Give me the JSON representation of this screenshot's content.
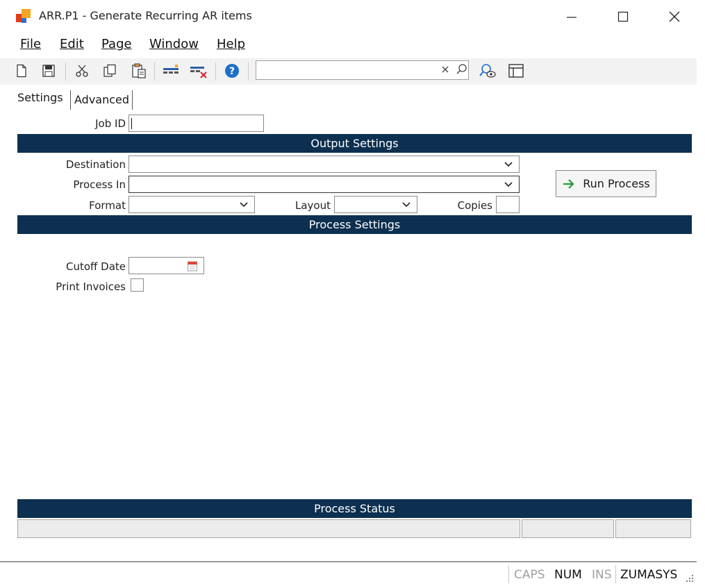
{
  "window": {
    "title": "ARR.P1 - Generate Recurring AR items",
    "minimize_label": "—",
    "maximize_label": "☐",
    "close_label": "✕"
  },
  "menu": {
    "items": [
      {
        "label": "File"
      },
      {
        "label": "Edit"
      },
      {
        "label": "Page"
      },
      {
        "label": "Window"
      },
      {
        "label": "Help"
      }
    ]
  },
  "toolbar": {
    "icons": [
      "new-document-icon",
      "save-icon",
      "cut-icon",
      "copy-icon",
      "paste-icon",
      "insert-row-icon",
      "delete-row-icon",
      "help-icon",
      "find-icon",
      "layout-icon"
    ],
    "search": {
      "value": "",
      "placeholder": ""
    }
  },
  "tabs": [
    {
      "label": "Settings",
      "active": true
    },
    {
      "label": "Advanced",
      "active": false
    }
  ],
  "form": {
    "job_id_label": "Job ID",
    "job_id_value": "",
    "output_settings_header": "Output Settings",
    "destination_label": "Destination",
    "destination_value": "",
    "process_in_label": "Process In",
    "process_in_value": "",
    "format_label": "Format",
    "format_value": "",
    "layout_label": "Layout",
    "layout_value": "",
    "copies_label": "Copies",
    "copies_value": "",
    "run_process_label": "Run Process",
    "process_settings_header": "Process Settings",
    "cutoff_date_label": "Cutoff Date",
    "cutoff_date_value": "",
    "print_invoices_label": "Print Invoices",
    "print_invoices_checked": false,
    "process_status_header": "Process Status"
  },
  "statusbar": {
    "caps": "CAPS",
    "num": "NUM",
    "ins": "INS",
    "company": "ZUMASYS"
  },
  "colors": {
    "band": "#0d3050",
    "accent_green": "#1e9e3a",
    "help_blue": "#1f6fc9"
  }
}
